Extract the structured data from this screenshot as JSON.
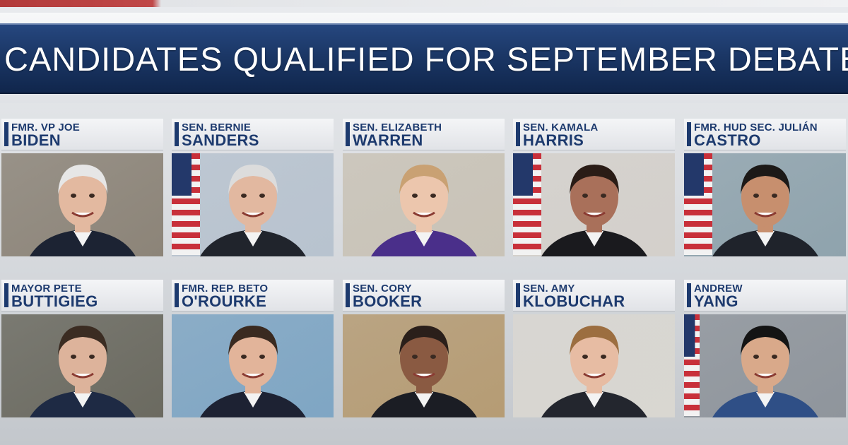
{
  "headline": "CANDIDATES QUALIFIED FOR SEPTEMBER DEBATE",
  "candidates": [
    {
      "title": "FMR. VP JOE",
      "name": "BIDEN",
      "bg": "#8c8478",
      "jacket": "#1c2333",
      "hair": "#e6e6e6",
      "skin": "#e3b9a0",
      "flag": "none"
    },
    {
      "title": "SEN. BERNIE",
      "name": "SANDERS",
      "bg": "#b8c3cf",
      "jacket": "#20242c",
      "hair": "#dcdcdc",
      "skin": "#e2b8a0",
      "flag": "us-left"
    },
    {
      "title": "SEN. ELIZABETH",
      "name": "WARREN",
      "bg": "#c9c3b7",
      "jacket": "#4a2f8a",
      "hair": "#c9a173",
      "skin": "#ecc6ad",
      "flag": "none"
    },
    {
      "title": "SEN. KAMALA",
      "name": "HARRIS",
      "bg": "#d4d0cb",
      "jacket": "#1a1a1e",
      "hair": "#2a1c16",
      "skin": "#a9705a",
      "flag": "us-left"
    },
    {
      "title": "FMR. HUD SEC. JULIÁN",
      "name": "CASTRO",
      "bg": "#8fa3ad",
      "jacket": "#1f232b",
      "hair": "#1c1917",
      "skin": "#c78f6e",
      "flag": "us-left"
    },
    {
      "title": "MAYOR PETE",
      "name": "BUTTIGIEG",
      "bg": "#6b6a60",
      "jacket": "#1e2a44",
      "hair": "#3b2c22",
      "skin": "#ddb39b",
      "flag": "none"
    },
    {
      "title": "FMR. REP. BETO",
      "name": "O'ROURKE",
      "bg": "#7fa6c4",
      "jacket": "#1d2233",
      "hair": "#3a2a20",
      "skin": "#e2b49a",
      "flag": "none"
    },
    {
      "title": "SEN. CORY",
      "name": "BOOKER",
      "bg": "#b69c74",
      "jacket": "#1b1d24",
      "hair": "#2a1f1a",
      "skin": "#8a5a42",
      "flag": "none"
    },
    {
      "title": "SEN. AMY",
      "name": "KLOBUCHAR",
      "bg": "#d9d7d1",
      "jacket": "#23262e",
      "hair": "#9c6e40",
      "skin": "#e7bca3",
      "flag": "none"
    },
    {
      "title": "ANDREW",
      "name": "YANG",
      "bg": "#8f959c",
      "jacket": "#2f4f86",
      "hair": "#141414",
      "skin": "#d9a98a",
      "flag": "us-left-small"
    }
  ]
}
